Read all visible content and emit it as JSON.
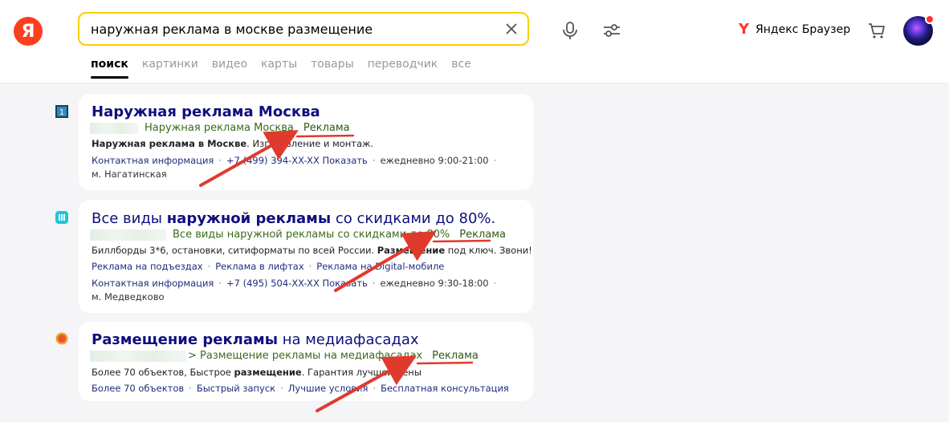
{
  "header": {
    "logo_text": "Я",
    "search_value": "наружная реклама в москве размещение",
    "browser_label": "Яндекс Браузер"
  },
  "tabs": [
    "поиск",
    "картинки",
    "видео",
    "карты",
    "товары",
    "переводчик",
    "все"
  ],
  "results": [
    {
      "title_bold": "Наружная реклама Москва",
      "url_text": "Наружная реклама Москва",
      "ad_label": "Реклама",
      "desc_bold": "Наружная реклама в Москве",
      "desc_rest": ". Изготовление и монтаж.",
      "contact": "Контактная информация",
      "phone": "+7 (499) 394-XX-XX Показать",
      "hours": "ежедневно 9:00-21:00",
      "metro": "м. Нагатинская"
    },
    {
      "title_pre": "Все виды ",
      "title_bold": "наружной рекламы",
      "title_post": " со скидками до 80%.",
      "url_text": "Все виды наружной рекламы со скидками до 80%",
      "ad_label": "Реклама",
      "desc_pre": "Биллборды 3*6, остановки, ситиформаты по всей России. ",
      "desc_bold": "Размещение",
      "desc_post": " под ключ. Звони!",
      "sitelinks": [
        "Реклама на подъездах",
        "Реклама в лифтах",
        "Реклама на Digital-мобиле"
      ],
      "contact": "Контактная информация",
      "phone": "+7 (495) 504-XX-XX Показать",
      "hours": "ежедневно 9:30-18:00",
      "metro": "м. Медведково"
    },
    {
      "title_bold": "Размещение рекламы",
      "title_post": " на медиафасадах",
      "url_text": "> Размещение рекламы на медиафасадах",
      "ad_label": "Реклама",
      "desc_pre": "Более 70 объектов, Быстрое ",
      "desc_bold": "размещение",
      "desc_post": ". Гарантия лучшей цены",
      "sitelinks": [
        "Более 70 объектов",
        "Быстрый запуск",
        "Лучшие условия",
        "Бесплатная консультация"
      ]
    }
  ]
}
